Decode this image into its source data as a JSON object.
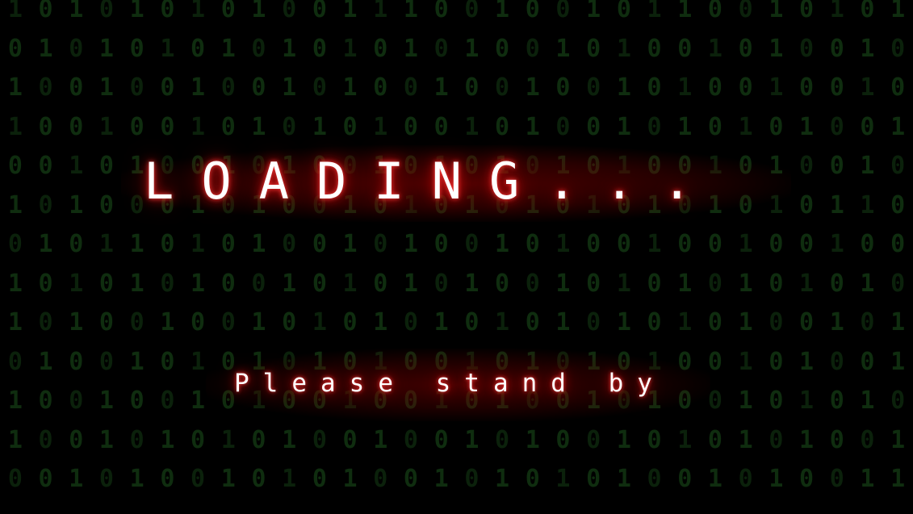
{
  "screen": {
    "title": "LOADING...",
    "subtitle": "Please stand by"
  },
  "background": {
    "binary_rows": [
      "101010101001110010010110010101",
      "010101010101010100101001010010",
      "100100100101001001001010010010",
      "100100101010100101001010101001",
      "001010010100101010101001010010",
      "101000101001010101010101010110",
      "010110101001010010100100100100",
      "101010100101010100101010101010",
      "101001001010101010101010100101",
      "010010101010100101010100101001",
      "100100101001001010010100101010",
      "100101010100100101001010101001",
      "001010010101001010101001010011"
    ]
  },
  "colors": {
    "background": "#000000",
    "binary_digits": "#0f2d0f",
    "text": "#ffffff",
    "glow": "#c80000"
  }
}
